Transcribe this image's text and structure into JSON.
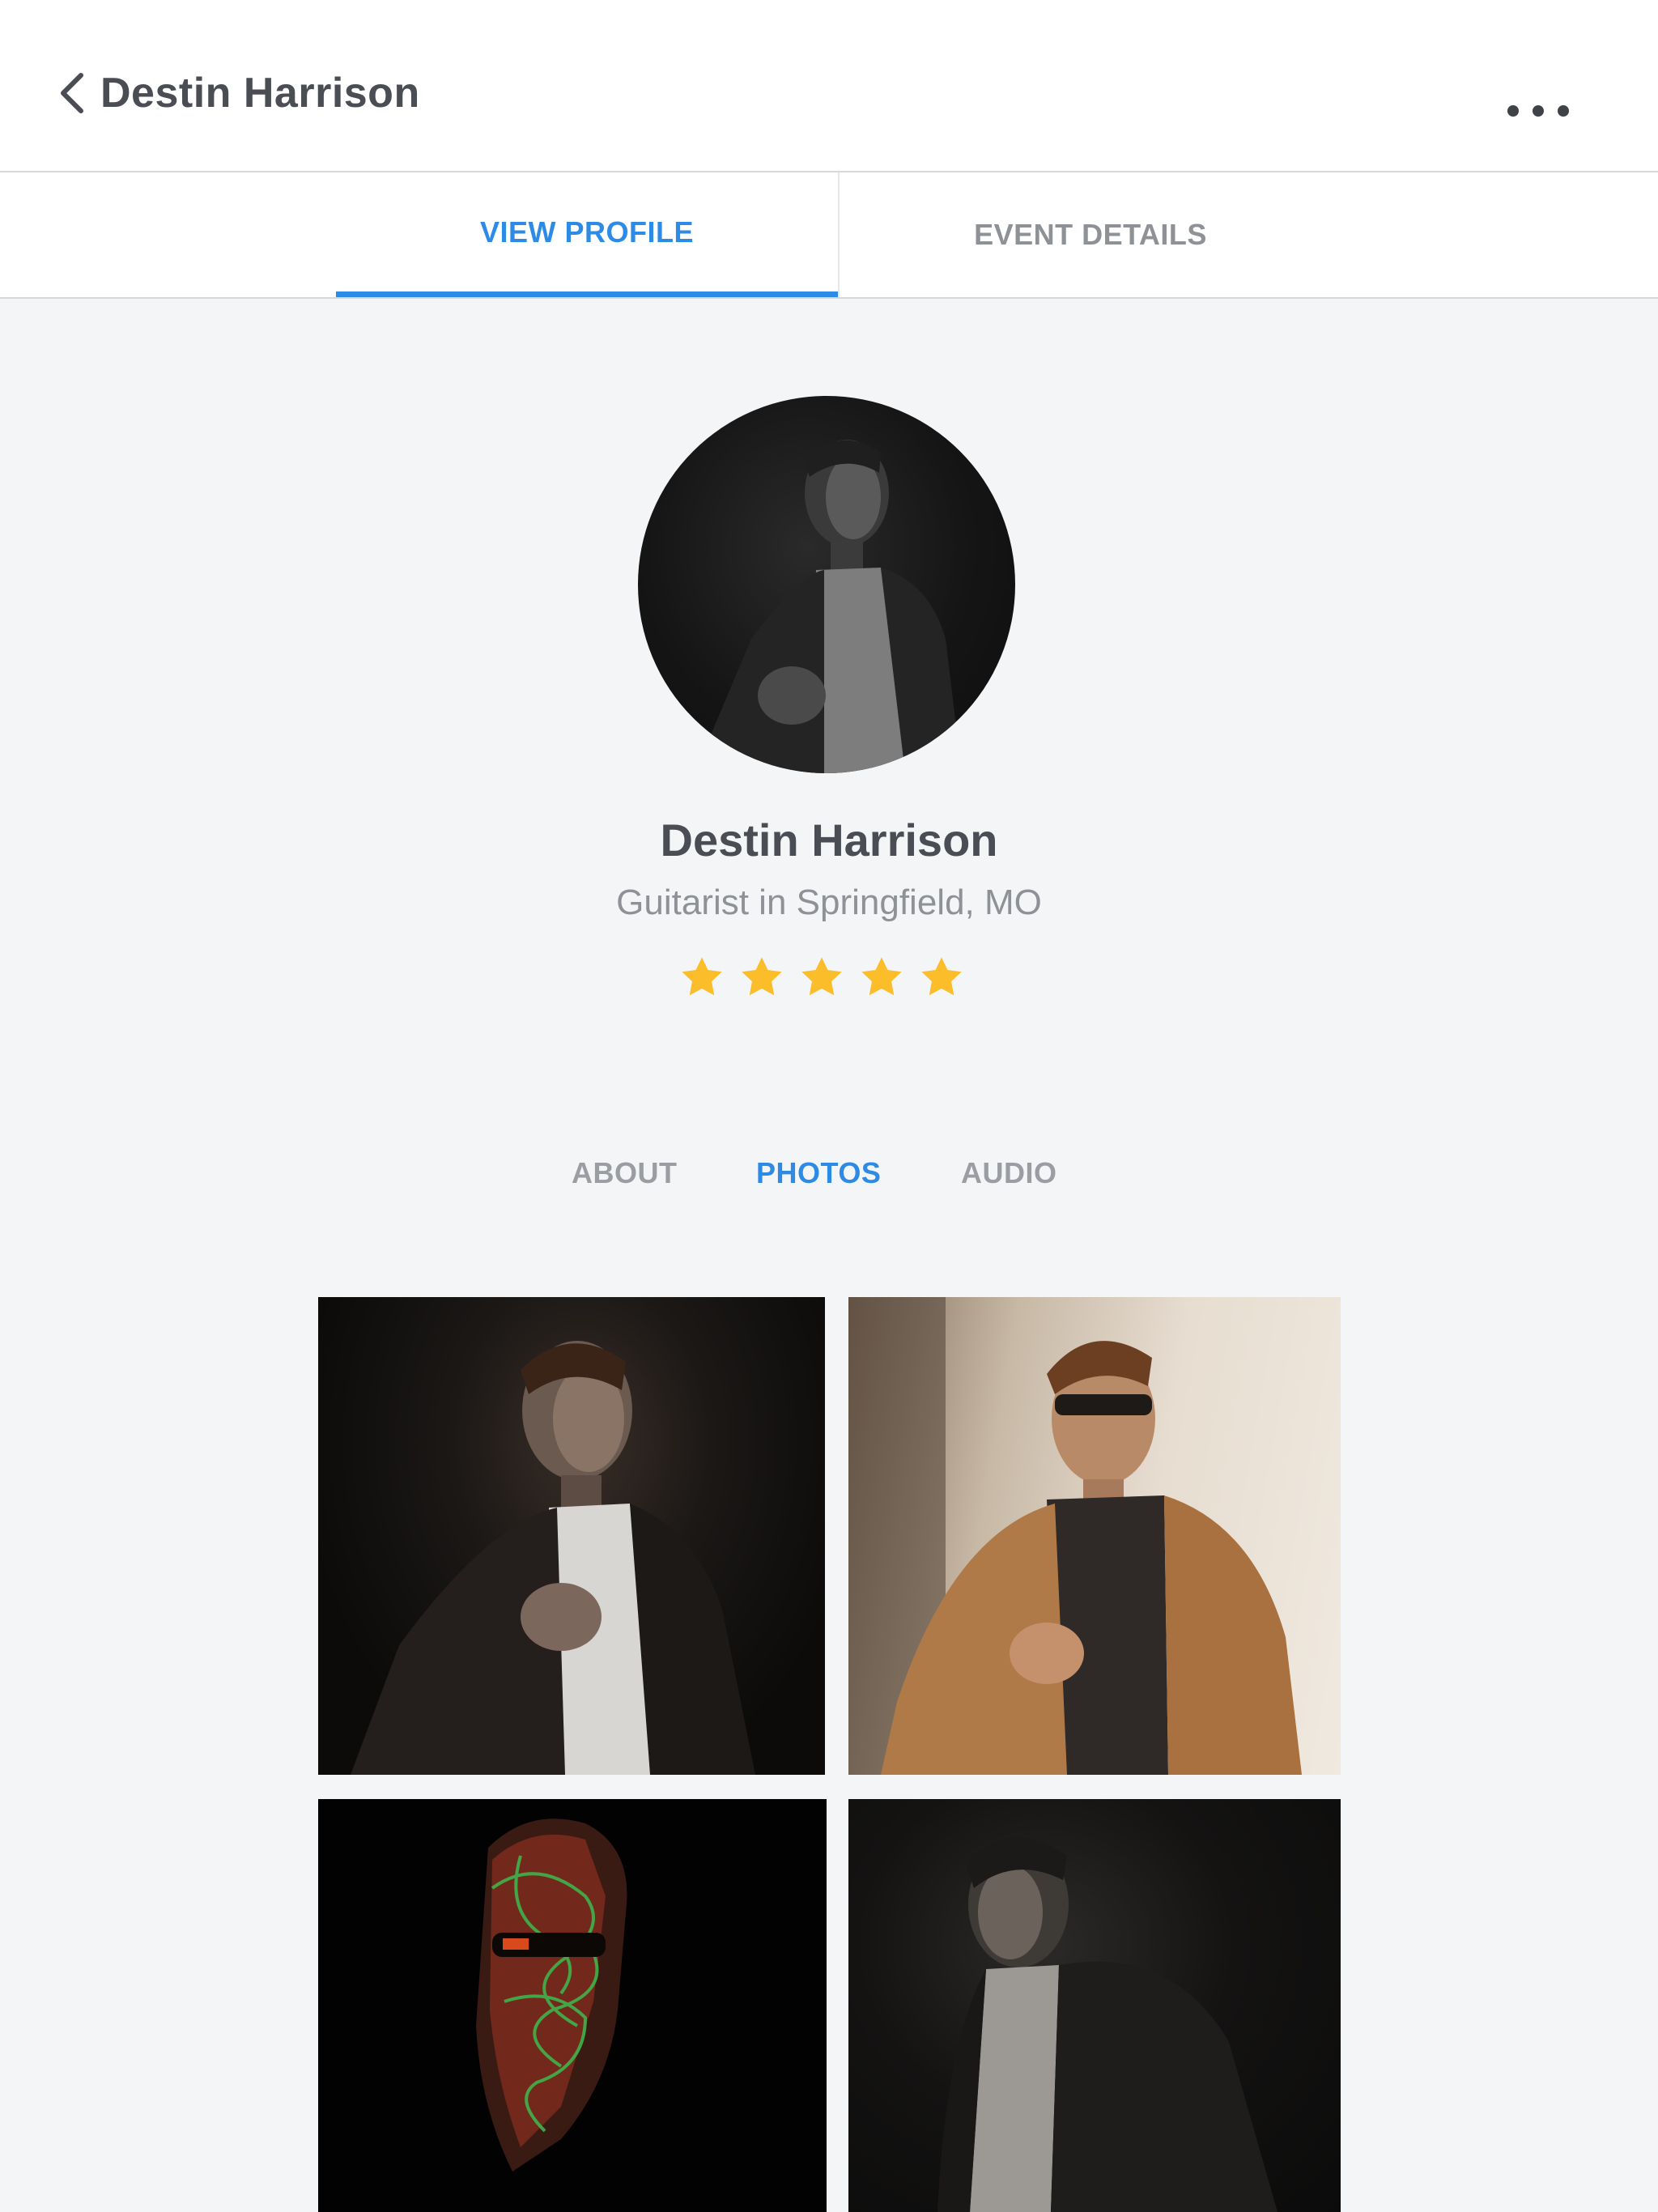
{
  "header": {
    "title": "Destin Harrison",
    "back_icon": "chevron-left-icon",
    "more_icon": "more-horizontal-icon"
  },
  "tabs": [
    {
      "label": "VIEW PROFILE",
      "active": true
    },
    {
      "label": "EVENT DETAILS",
      "active": false
    }
  ],
  "profile": {
    "name": "Destin Harrison",
    "subtitle": "Guitarist in Springfield, MO",
    "rating": 5,
    "rating_max": 5
  },
  "section_tabs": [
    {
      "label": "ABOUT",
      "active": false
    },
    {
      "label": "PHOTOS",
      "active": true
    },
    {
      "label": "AUDIO",
      "active": false
    }
  ],
  "colors": {
    "accent": "#2d8be6",
    "star": "#fbbd2a",
    "text_primary": "#4a4d53",
    "text_secondary": "#8e9196",
    "background": "#f4f5f7"
  }
}
